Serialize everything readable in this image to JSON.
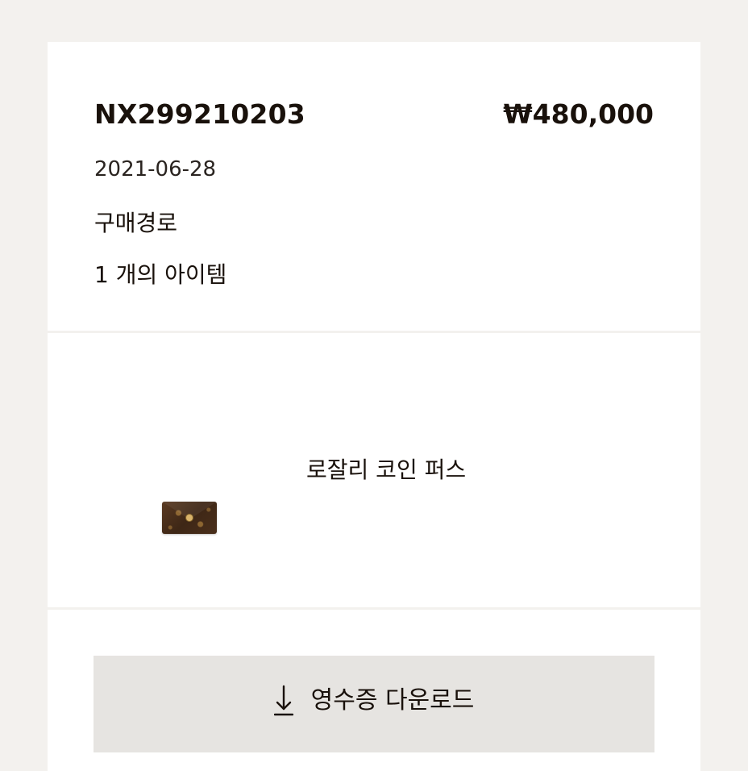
{
  "order": {
    "number": "NX299210203",
    "price": "₩480,000",
    "date": "2021-06-28",
    "channel": "구매경로",
    "item_count": "1 개의 아이템"
  },
  "product": {
    "name": "로잘리 코인 퍼스",
    "thumbnail_icon": "coin-purse-product-image"
  },
  "actions": {
    "download_label": "영수증 다운로드",
    "download_icon": "download-arrow-icon"
  },
  "colors": {
    "background": "#f3f1ee",
    "card": "#ffffff",
    "button": "#e6e4e1",
    "text": "#19110b"
  }
}
